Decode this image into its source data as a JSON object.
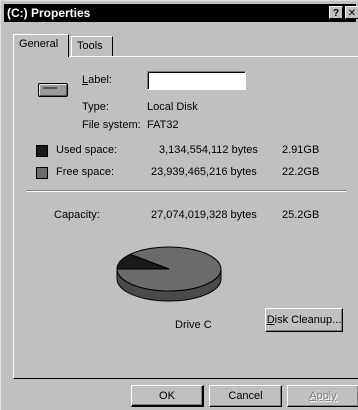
{
  "window": {
    "title": "(C:) Properties",
    "help_glyph": "?",
    "close_glyph": "✕"
  },
  "tabs": [
    {
      "label": "General",
      "selected": true
    },
    {
      "label": "Tools",
      "selected": false
    }
  ],
  "general": {
    "label_caption": "Label:",
    "label_value": "",
    "type_caption": "Type:",
    "type_value": "Local Disk",
    "fs_caption": "File system:",
    "fs_value": "FAT32",
    "used": {
      "caption": "Used space:",
      "bytes": "3,134,554,112 bytes",
      "size": "2.91GB",
      "color": "#1a1a1a"
    },
    "free": {
      "caption": "Free space:",
      "bytes": "23,939,465,216 bytes",
      "size": "22.2GB",
      "color": "#6b6b6b"
    },
    "capacity": {
      "caption": "Capacity:",
      "bytes": "27,074,019,328 bytes",
      "size": "25.2GB"
    },
    "drive_caption": "Drive C",
    "cleanup_label": "Disk Cleanup...",
    "used_fraction": 0.1158
  },
  "buttons": {
    "ok": "OK",
    "cancel": "Cancel",
    "apply": "Apply"
  }
}
